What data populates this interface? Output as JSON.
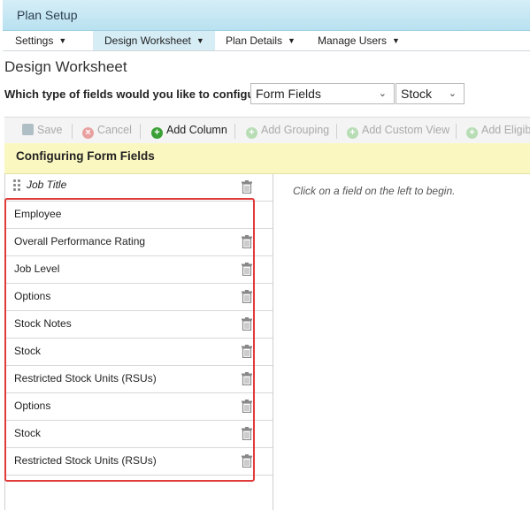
{
  "header": {
    "title": "Plan Setup"
  },
  "tabs": [
    {
      "label": "Settings",
      "active": false
    },
    {
      "label": "Design Worksheet",
      "active": true
    },
    {
      "label": "Plan Details",
      "active": false
    },
    {
      "label": "Manage Users",
      "active": false
    }
  ],
  "page": {
    "title": "Design Worksheet",
    "question": "Which type of fields would you like to configure:",
    "field_type_select": "Form Fields",
    "component_select": "Stock"
  },
  "toolbar": {
    "save": "Save",
    "cancel": "Cancel",
    "add_column": "Add Column",
    "add_grouping": "Add Grouping",
    "add_custom_view": "Add Custom View",
    "add_eligibility": "Add Eligib"
  },
  "config_title": "Configuring Form Fields",
  "fields": [
    {
      "label": "Job Title",
      "italic": true,
      "deletable": true
    },
    {
      "label": "Employee",
      "italic": false,
      "deletable": false
    },
    {
      "label": "Overall Performance Rating",
      "italic": false,
      "deletable": true
    },
    {
      "label": "Job Level",
      "italic": false,
      "deletable": true
    },
    {
      "label": "Options",
      "italic": false,
      "deletable": true
    },
    {
      "label": "Stock Notes",
      "italic": false,
      "deletable": true
    },
    {
      "label": "Stock",
      "italic": false,
      "deletable": true
    },
    {
      "label": "Restricted Stock Units (RSUs)",
      "italic": false,
      "deletable": true
    },
    {
      "label": "Options",
      "italic": false,
      "deletable": true
    },
    {
      "label": "Stock",
      "italic": false,
      "deletable": true
    },
    {
      "label": "Restricted Stock Units (RSUs)",
      "italic": false,
      "deletable": true
    }
  ],
  "right_pane_message": "Click on a field on the left to begin.",
  "colors": {
    "highlight": "#e03c3c",
    "config_bar": "#fbf7c0",
    "header": "#c7e8f4"
  }
}
